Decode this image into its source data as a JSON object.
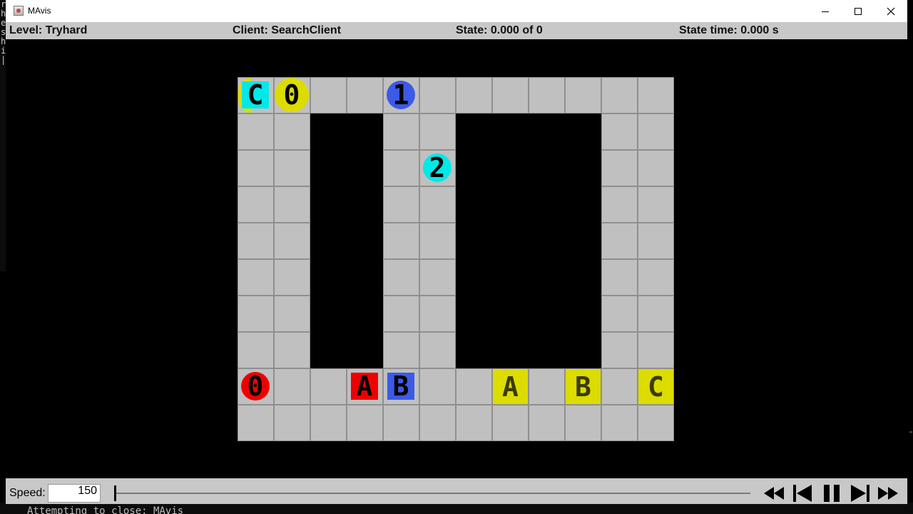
{
  "window": {
    "title": "MAvis"
  },
  "terminal": {
    "left_chars": [
      "r",
      "h",
      "e",
      "s",
      "h",
      "i",
      "|"
    ],
    "bottom_text": "Attempting to close: MAvis"
  },
  "status": {
    "level": "Level: Tryhard",
    "client": "Client: SearchClient",
    "state": "State: 0.000 of 0",
    "state_time": "State time: 0.000 s"
  },
  "colors": {
    "cyan": "#00e8e8",
    "yellow": "#dcdc00",
    "blue": "#3c5ae6",
    "red": "#ee0000",
    "floor": "#c0c0c0",
    "wall": "#000000"
  },
  "level_map": {
    "cols": 12,
    "rows": 10,
    "walls": [
      [
        1,
        2
      ],
      [
        1,
        3
      ],
      [
        1,
        6
      ],
      [
        1,
        7
      ],
      [
        1,
        8
      ],
      [
        1,
        9
      ],
      [
        2,
        2
      ],
      [
        2,
        3
      ],
      [
        2,
        6
      ],
      [
        2,
        7
      ],
      [
        2,
        8
      ],
      [
        2,
        9
      ],
      [
        3,
        2
      ],
      [
        3,
        3
      ],
      [
        3,
        6
      ],
      [
        3,
        7
      ],
      [
        3,
        8
      ],
      [
        3,
        9
      ],
      [
        4,
        2
      ],
      [
        4,
        3
      ],
      [
        4,
        6
      ],
      [
        4,
        7
      ],
      [
        4,
        8
      ],
      [
        4,
        9
      ],
      [
        5,
        2
      ],
      [
        5,
        3
      ],
      [
        5,
        6
      ],
      [
        5,
        7
      ],
      [
        5,
        8
      ],
      [
        5,
        9
      ],
      [
        6,
        2
      ],
      [
        6,
        3
      ],
      [
        6,
        6
      ],
      [
        6,
        7
      ],
      [
        6,
        8
      ],
      [
        6,
        9
      ],
      [
        7,
        2
      ],
      [
        7,
        3
      ],
      [
        7,
        6
      ],
      [
        7,
        7
      ],
      [
        7,
        8
      ],
      [
        7,
        9
      ]
    ],
    "goals": [
      {
        "label": "C",
        "row": 0,
        "col": 0,
        "color": "yellow"
      },
      {
        "label": "A",
        "row": 8,
        "col": 7,
        "color": "yellow"
      },
      {
        "label": "B",
        "row": 8,
        "col": 9,
        "color": "yellow"
      },
      {
        "label": "C",
        "row": 8,
        "col": 11,
        "color": "yellow"
      }
    ],
    "boxes": [
      {
        "label": "C",
        "row": 0,
        "col": 0,
        "color": "cyan"
      },
      {
        "label": "A",
        "row": 8,
        "col": 3,
        "color": "red"
      },
      {
        "label": "B",
        "row": 8,
        "col": 4,
        "color": "blue"
      }
    ],
    "agents": [
      {
        "label": "0",
        "row": 0,
        "col": 1,
        "color": "yellow"
      },
      {
        "label": "1",
        "row": 0,
        "col": 4,
        "color": "blue"
      },
      {
        "label": "2",
        "row": 2,
        "col": 5,
        "color": "cyan"
      },
      {
        "label": "0",
        "row": 8,
        "col": 0,
        "color": "red"
      }
    ]
  },
  "controls": {
    "speed_label": "Speed:",
    "speed_value": "150",
    "slider_position": 0,
    "buttons": [
      "skip-to-start",
      "step-back",
      "pause",
      "step-forward",
      "skip-to-end"
    ]
  }
}
